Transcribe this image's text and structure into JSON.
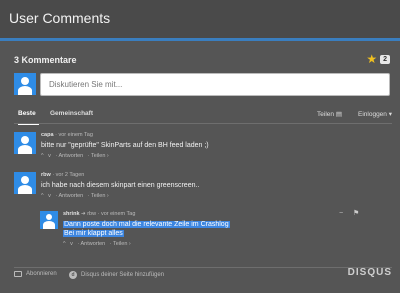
{
  "window": {
    "title": "User Comments"
  },
  "header": {
    "comment_count": "3 Kommentare",
    "favorite_count": "2"
  },
  "compose": {
    "placeholder": "Diskutieren Sie mit..."
  },
  "tabs": {
    "best": "Beste",
    "community": "Gemeinschaft",
    "share": "Teilen",
    "login": "Einloggen"
  },
  "comments": [
    {
      "author": "capa",
      "time": "· vor einem Tag",
      "text": "bitte nur \"geprüfte\" SkinParts auf den BH feed laden ;)",
      "actions": [
        "^",
        "v",
        "· Antworten",
        "· Teilen ›"
      ]
    },
    {
      "author": "rbw",
      "time": "· vor 2 Tagen",
      "text": "ich habe nach diesem skinpart einen greenscreen..",
      "actions": [
        "^",
        "v",
        "· Antworten",
        "· Teilen ›"
      ]
    },
    {
      "author": "shrink",
      "reply_to": "rbw",
      "time": "· vor einem Tag",
      "lines": [
        "Dann poste doch mal die relevante Zeile im Crashlog",
        "Bei mir klappt alles"
      ],
      "actions": [
        "^",
        "v",
        "· Antworten",
        "· Teilen ›"
      ]
    }
  ],
  "footer": {
    "subscribe": "Abonnieren",
    "add_disqus": "Disqus deiner Seite hinzufügen",
    "brand": "DISQUS"
  },
  "colors": {
    "accent": "#3a7ebf",
    "avatar": "#2f8ce6",
    "selection": "#3d86e0",
    "star": "#f0c020"
  }
}
